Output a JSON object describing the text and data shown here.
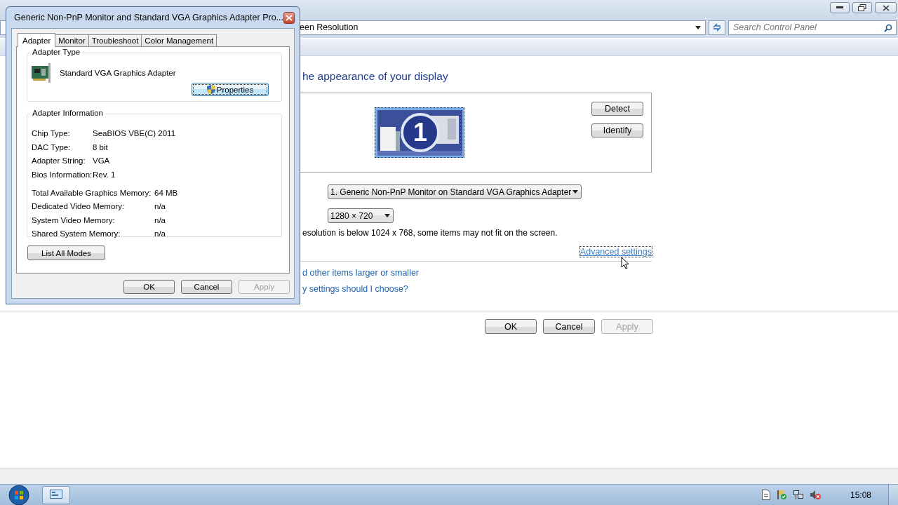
{
  "window": {
    "address": "een Resolution",
    "search": {
      "placeholder": "Search Control Panel"
    },
    "heading": "he appearance of your display",
    "monitor_number": "1",
    "side_buttons": [
      {
        "label": "Detect"
      },
      {
        "label": "Identify"
      }
    ],
    "display_select": "1. Generic Non-PnP Monitor on Standard VGA Graphics Adapter",
    "resolution_select": "1280 × 720",
    "warning": "esolution is below 1024 x 768, some items may not fit on the screen.",
    "advanced_link": "Advanced settings",
    "links": [
      "d other items larger or smaller",
      "y settings should I choose?"
    ],
    "buttons": [
      {
        "label": "OK",
        "disabled": false
      },
      {
        "label": "Cancel",
        "disabled": false
      },
      {
        "label": "Apply",
        "disabled": true
      }
    ]
  },
  "dialog": {
    "title": "Generic Non-PnP Monitor and Standard VGA Graphics Adapter Pro...",
    "tabs": [
      {
        "label": "Adapter",
        "selected": true
      },
      {
        "label": "Monitor",
        "selected": false
      },
      {
        "label": "Troubleshoot",
        "selected": false
      },
      {
        "label": "Color Management",
        "selected": false
      }
    ],
    "adapter_type": {
      "heading": "Adapter Type",
      "name": "Standard VGA Graphics Adapter",
      "button": "Properties"
    },
    "adapter_info": {
      "heading": "Adapter Information",
      "rows": [
        {
          "label": "Chip Type:",
          "value": "SeaBIOS VBE(C) 2011"
        },
        {
          "label": "DAC Type:",
          "value": "8 bit"
        },
        {
          "label": "Adapter String:",
          "value": "VGA"
        },
        {
          "label": "Bios Information:",
          "value": "Rev. 1"
        }
      ],
      "memory_rows": [
        {
          "label": "Total Available Graphics Memory:",
          "value": "64 MB"
        },
        {
          "label": "Dedicated Video Memory:",
          "value": "n/a"
        },
        {
          "label": "System Video Memory:",
          "value": "n/a"
        },
        {
          "label": "Shared System Memory:",
          "value": "n/a"
        }
      ]
    },
    "list_modes_button": "List All Modes",
    "buttons": [
      {
        "label": "OK",
        "disabled": false
      },
      {
        "label": "Cancel",
        "disabled": false
      },
      {
        "label": "Apply",
        "disabled": true
      }
    ]
  },
  "taskbar": {
    "clock": "15:08"
  }
}
